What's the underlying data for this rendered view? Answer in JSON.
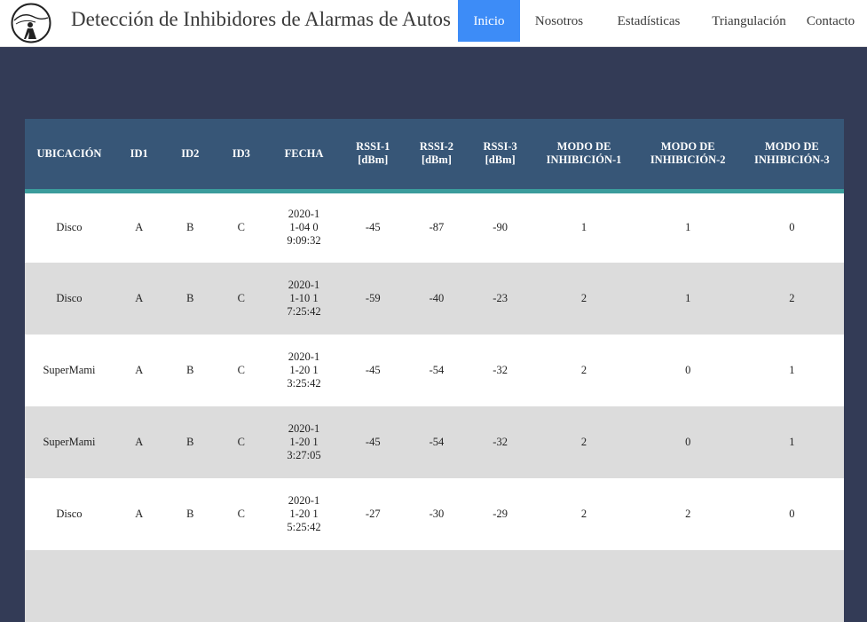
{
  "header": {
    "title": "Detección de Inhibidores de Alarmas de Autos",
    "logo_icon": "silhouette-logo-icon"
  },
  "nav": {
    "items": [
      {
        "label": "Inicio",
        "active": true
      },
      {
        "label": "Nosotros",
        "active": false
      },
      {
        "label": "Estadísticas",
        "active": false
      },
      {
        "label": "Triangulación",
        "active": false
      },
      {
        "label": "Contacto",
        "active": false
      }
    ]
  },
  "table": {
    "columns": [
      "UBICACIÓN",
      "ID1",
      "ID2",
      "ID3",
      "FECHA",
      "RSSI-1 [dBm]",
      "RSSI-2 [dBm]",
      "RSSI-3 [dBm]",
      "MODO DE INHIBICIÓN-1",
      "MODO DE INHIBICIÓN-2",
      "MODO DE INHIBICIÓN-3"
    ],
    "rows": [
      [
        "Disco",
        "A",
        "B",
        "C",
        "2020-11-04 09:09:32",
        "-45",
        "-87",
        "-90",
        "1",
        "1",
        "0"
      ],
      [
        "Disco",
        "A",
        "B",
        "C",
        "2020-11-10 17:25:42",
        "-59",
        "-40",
        "-23",
        "2",
        "1",
        "2"
      ],
      [
        "SuperMami",
        "A",
        "B",
        "C",
        "2020-11-20 13:25:42",
        "-45",
        "-54",
        "-32",
        "2",
        "0",
        "1"
      ],
      [
        "SuperMami",
        "A",
        "B",
        "C",
        "2020-11-20 13:27:05",
        "-45",
        "-54",
        "-32",
        "2",
        "0",
        "1"
      ],
      [
        "Disco",
        "A",
        "B",
        "C",
        "2020-11-20 15:25:42",
        "-27",
        "-30",
        "-29",
        "2",
        "2",
        "0"
      ]
    ]
  },
  "colors": {
    "page_background": "#333b56",
    "nav_active": "#3d8cf7",
    "table_header": "#375677",
    "header_accent": "#3b9c9c",
    "row_alt": "#dcdcdc"
  }
}
